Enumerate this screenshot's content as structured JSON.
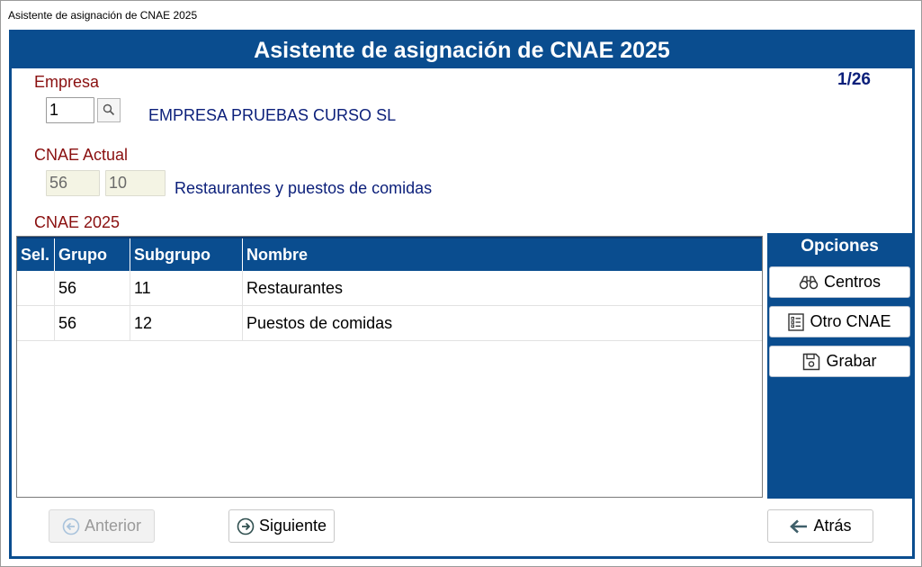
{
  "window": {
    "title": "Asistente de asignación de CNAE 2025"
  },
  "header": {
    "title": "Asistente de asignación de CNAE 2025",
    "counter": "1/26"
  },
  "empresa": {
    "label": "Empresa",
    "code": "1",
    "name": "EMPRESA PRUEBAS CURSO SL"
  },
  "cnae_actual": {
    "label": "CNAE Actual",
    "grupo": "56",
    "subgrupo": "10",
    "description": "Restaurantes y puestos de comidas"
  },
  "cnae2025": {
    "label": "CNAE 2025",
    "columns": [
      "Sel.",
      "Grupo",
      "Subgrupo",
      "Nombre"
    ],
    "rows": [
      {
        "sel": "",
        "grupo": "56",
        "subgrupo": "11",
        "nombre": "Restaurantes"
      },
      {
        "sel": "",
        "grupo": "56",
        "subgrupo": "12",
        "nombre": "Puestos de comidas"
      }
    ]
  },
  "options": {
    "title": "Opciones",
    "centros": "Centros",
    "otro_cnae": "Otro CNAE",
    "grabar": "Grabar"
  },
  "footer": {
    "anterior": "Anterior",
    "siguiente": "Siguiente",
    "atras": "Atrás"
  },
  "icons": {
    "search": "magnifier-icon",
    "centros": "binoculars-icon",
    "otro_cnae": "list-checklist-icon",
    "grabar": "floppy-disk-icon",
    "anterior": "circle-arrow-left-icon",
    "siguiente": "circle-arrow-right-icon",
    "atras": "arrow-left-icon"
  },
  "colors": {
    "accent": "#0a4d8f",
    "label_red": "#8a1010",
    "value_blue": "#0b1f7a"
  }
}
